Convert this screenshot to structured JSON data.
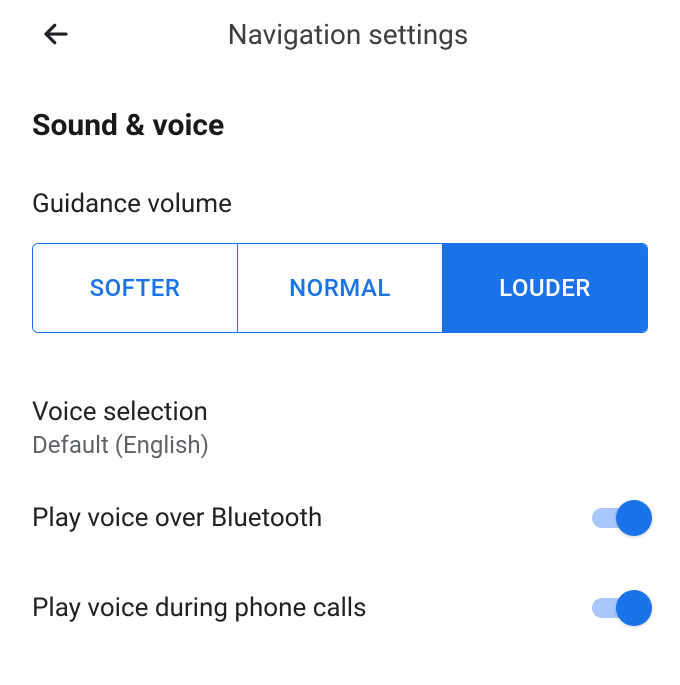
{
  "header": {
    "title": "Navigation settings"
  },
  "section": {
    "title": "Sound & voice"
  },
  "guidance_volume": {
    "label": "Guidance volume",
    "options": [
      "SOFTER",
      "NORMAL",
      "LOUDER"
    ],
    "selected": "LOUDER"
  },
  "voice_selection": {
    "label": "Voice selection",
    "value": "Default (English)"
  },
  "bluetooth": {
    "label": "Play voice over Bluetooth",
    "enabled": true
  },
  "phone_calls": {
    "label": "Play voice during phone calls",
    "enabled": true
  },
  "colors": {
    "accent": "#1a73e8"
  }
}
